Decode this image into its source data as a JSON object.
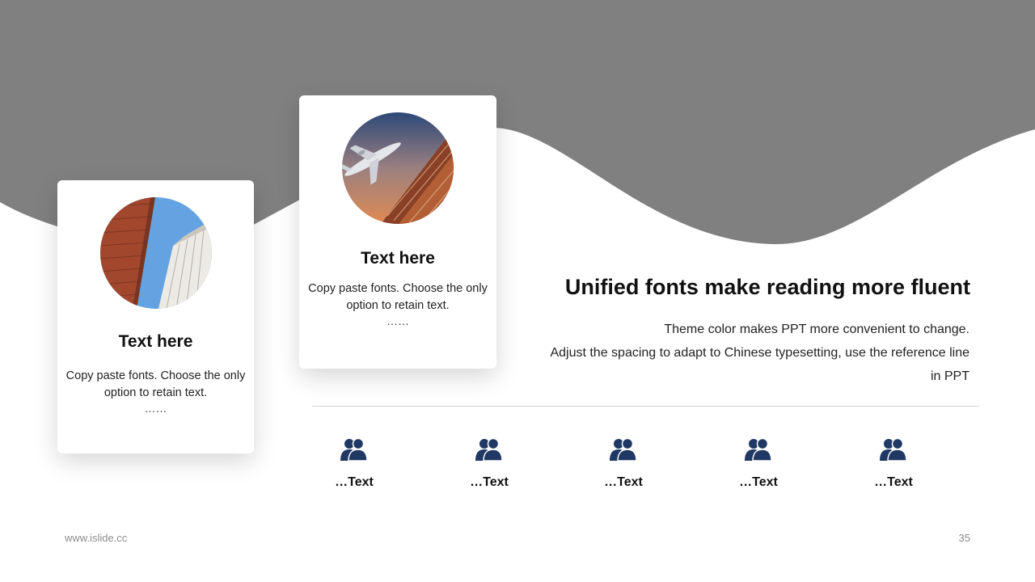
{
  "theme": {
    "wave_color": "#808080",
    "icon_color": "#1f3864",
    "sky_color": "#64a2e2"
  },
  "cards": [
    {
      "image": "skyscrapers-photo",
      "title": "Text here",
      "text": "Copy paste fonts. Choose the only option to retain text.",
      "ellipsis": "……"
    },
    {
      "image": "airplane-building-photo",
      "title": "Text here",
      "text": "Copy paste fonts. Choose the only option to retain text.",
      "ellipsis": "……"
    }
  ],
  "main": {
    "heading": "Unified fonts make reading more fluent",
    "line1": "Theme color makes PPT more convenient to change.",
    "line2": "Adjust the spacing to adapt to Chinese typesetting, use the reference line in PPT"
  },
  "people": [
    {
      "icon": "users-icon",
      "label": "…Text"
    },
    {
      "icon": "users-icon",
      "label": "…Text"
    },
    {
      "icon": "users-icon",
      "label": "…Text"
    },
    {
      "icon": "users-icon",
      "label": "…Text"
    },
    {
      "icon": "users-icon",
      "label": "…Text"
    }
  ],
  "footer": {
    "url": "www.islide.cc",
    "page": "35"
  }
}
